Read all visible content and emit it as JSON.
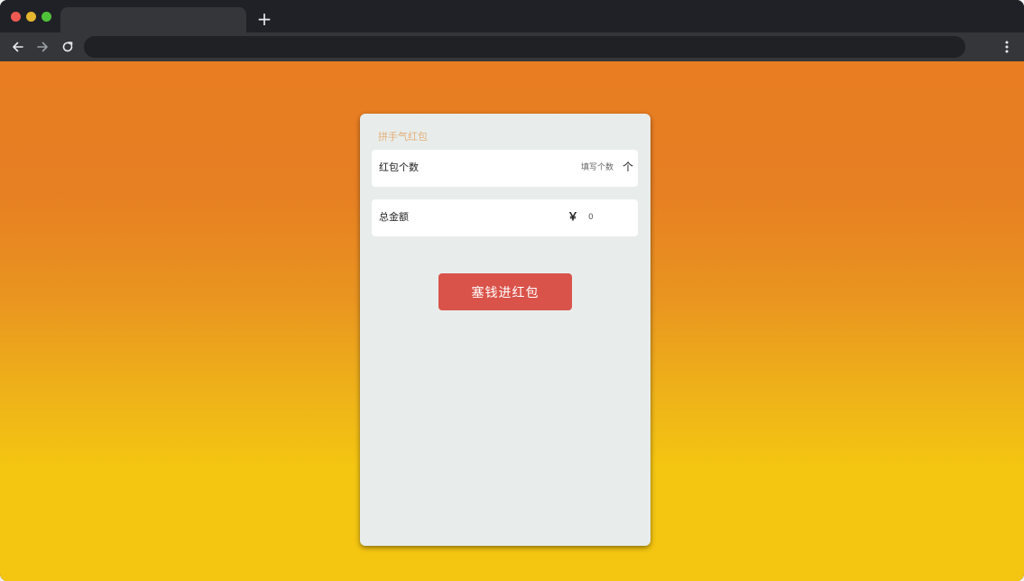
{
  "browser": {
    "new_tab_label": "+",
    "colors": {
      "tabbar": "#202126",
      "toolbar": "#35363a",
      "omnibox": "#202124"
    }
  },
  "page": {
    "background_gradient": [
      "#e97d22",
      "#f4c511"
    ],
    "card": {
      "title": "拼手气红包",
      "count_row": {
        "label": "红包个数",
        "placeholder": "填写个数",
        "value": "",
        "unit": "个"
      },
      "total_row": {
        "label": "总金额",
        "currency_symbol": "￥",
        "value": "0"
      },
      "submit_label": "塞钱进红包",
      "submit_color": "#d9534a"
    }
  }
}
